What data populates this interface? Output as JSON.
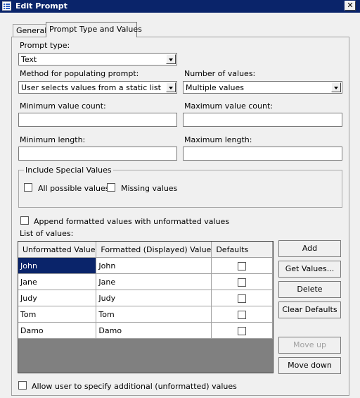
{
  "window": {
    "title": "Edit Prompt",
    "icon": "form-icon",
    "close_glyph": "✕"
  },
  "tabs": [
    {
      "label": "General"
    },
    {
      "label": "Prompt Type and Values"
    }
  ],
  "prompt_type": {
    "label": "Prompt type:",
    "value": "Text"
  },
  "method": {
    "label": "Method for populating prompt:",
    "value": "User selects values from a static list"
  },
  "num_values": {
    "label": "Number of values:",
    "value": "Multiple values"
  },
  "min_count": {
    "label": "Minimum value count:",
    "value": ""
  },
  "max_count": {
    "label": "Maximum value count:",
    "value": ""
  },
  "min_length": {
    "label": "Minimum length:",
    "value": ""
  },
  "max_length": {
    "label": "Maximum length:",
    "value": ""
  },
  "special_values": {
    "title": "Include Special Values",
    "all_possible": {
      "label": "All possible values",
      "checked": false
    },
    "missing": {
      "label": "Missing values",
      "checked": false
    }
  },
  "append_formatted": {
    "label": "Append formatted values with unformatted values",
    "checked": false
  },
  "list_of_values": {
    "label": "List of values:",
    "columns": [
      "Unformatted Value",
      "Formatted (Displayed) Value",
      "Defaults"
    ],
    "rows": [
      {
        "unformatted": "John",
        "formatted": "John",
        "default": false,
        "selected": true
      },
      {
        "unformatted": "Jane",
        "formatted": "Jane",
        "default": false,
        "selected": false
      },
      {
        "unformatted": "Judy",
        "formatted": "Judy",
        "default": false,
        "selected": false
      },
      {
        "unformatted": "Tom",
        "formatted": "Tom",
        "default": false,
        "selected": false
      },
      {
        "unformatted": "Damo",
        "formatted": "Damo",
        "default": false,
        "selected": false
      }
    ]
  },
  "buttons": {
    "add": "Add",
    "get_values": "Get Values...",
    "delete": "Delete",
    "clear_defaults": "Clear Defaults",
    "move_up": "Move up",
    "move_down": "Move down"
  },
  "allow_additional": {
    "label": "Allow user to specify additional (unformatted) values",
    "checked": false
  },
  "colors": {
    "titlebar": "#0a246a",
    "selection": "#0a246a",
    "background": "#f0f0f0"
  }
}
